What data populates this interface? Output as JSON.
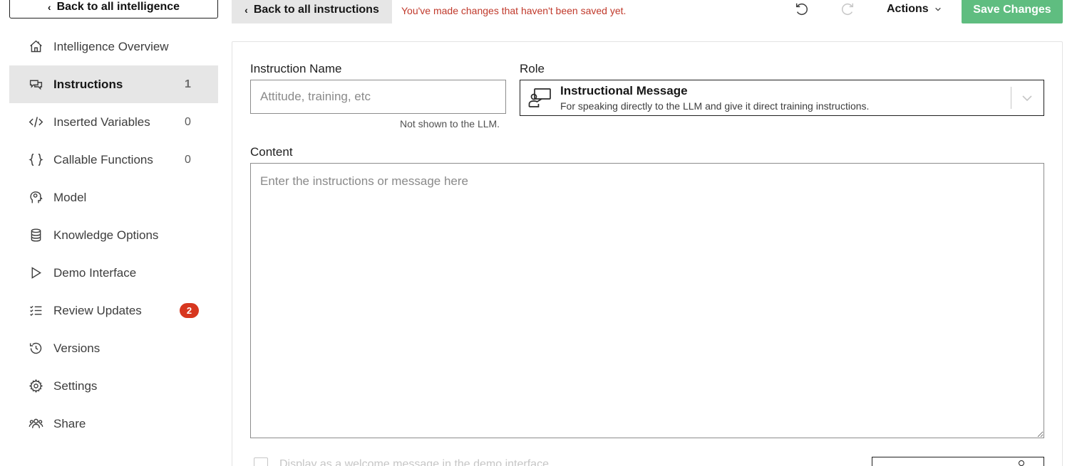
{
  "sidebar": {
    "back_label": "Back to all intelligence",
    "items": [
      {
        "label": "Intelligence Overview",
        "icon": "home-icon",
        "count": ""
      },
      {
        "label": "Instructions",
        "icon": "chat-icon",
        "count": "1"
      },
      {
        "label": "Inserted Variables",
        "icon": "code-icon",
        "count": "0"
      },
      {
        "label": "Callable Functions",
        "icon": "braces-icon",
        "count": "0"
      },
      {
        "label": "Model",
        "icon": "brain-head-icon",
        "count": ""
      },
      {
        "label": "Knowledge Options",
        "icon": "database-icon",
        "count": ""
      },
      {
        "label": "Demo Interface",
        "icon": "play-icon",
        "count": ""
      },
      {
        "label": "Review Updates",
        "icon": "checklist-icon",
        "badge": "2"
      },
      {
        "label": "Versions",
        "icon": "history-icon",
        "count": ""
      },
      {
        "label": "Settings",
        "icon": "gear-icon",
        "count": ""
      },
      {
        "label": "Share",
        "icon": "users-icon",
        "count": ""
      }
    ],
    "active_index": 1
  },
  "toolbar": {
    "back_label": "Back to all instructions",
    "unsaved_message": "You've made changes that haven't been saved yet.",
    "actions_label": "Actions",
    "save_label": "Save Changes"
  },
  "form": {
    "name_label": "Instruction Name",
    "name_placeholder": "Attitude, training, etc",
    "name_value": "",
    "name_helper": "Not shown to the LLM.",
    "role_label": "Role",
    "role_title": "Instructional Message",
    "role_description": "For speaking directly to the LLM and give it direct training instructions.",
    "content_label": "Content",
    "content_placeholder": "Enter the instructions or message here",
    "welcome_label": "Display as a welcome message in the demo interface"
  },
  "colors": {
    "accent_green": "#5fbd80",
    "warning_red": "#c0392b",
    "badge_red": "#d7371f",
    "active_bg": "#e6e6e6"
  }
}
